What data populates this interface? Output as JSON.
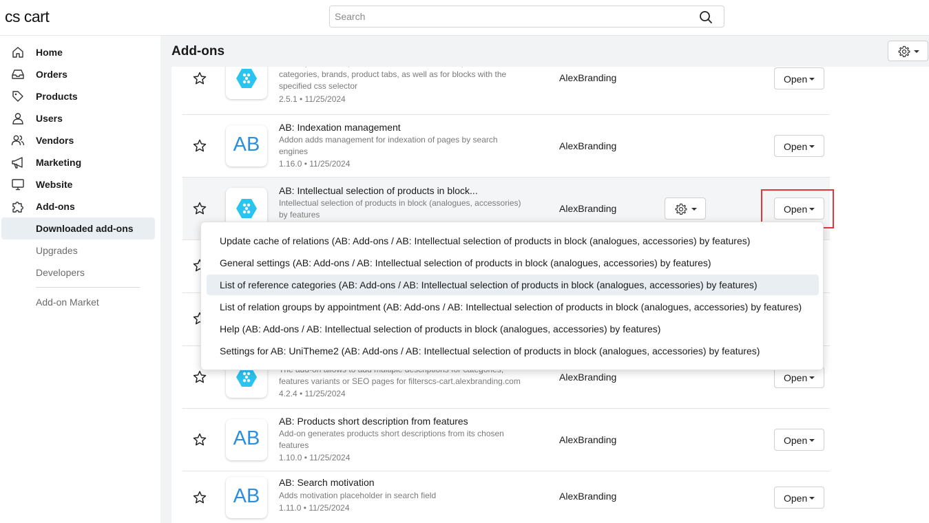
{
  "app": {
    "logo": "cs cart"
  },
  "search": {
    "placeholder": "Search"
  },
  "sidebar": {
    "items": [
      {
        "label": "Home",
        "icon": "home-icon"
      },
      {
        "label": "Orders",
        "icon": "inbox-icon"
      },
      {
        "label": "Products",
        "icon": "tag-icon"
      },
      {
        "label": "Users",
        "icon": "user-icon"
      },
      {
        "label": "Vendors",
        "icon": "users-icon"
      },
      {
        "label": "Marketing",
        "icon": "megaphone-icon"
      },
      {
        "label": "Website",
        "icon": "monitor-icon"
      },
      {
        "label": "Add-ons",
        "icon": "puzzle-icon"
      }
    ],
    "subitems": [
      {
        "label": "Downloaded add-ons",
        "active": true
      },
      {
        "label": "Upgrades",
        "active": false
      },
      {
        "label": "Developers",
        "active": false
      }
    ],
    "market": "Add-on Market"
  },
  "page": {
    "title": "Add-ons"
  },
  "addons": [
    {
      "title": "",
      "desc": "Allows you to hide part of the content in the description of categories, brands, product tabs, as well as for blocks with the specified css selector",
      "version": "2.5.1 • 11/25/2024",
      "developer": "AlexBranding",
      "icon": "hexagon-logo-icon",
      "action": "Open"
    },
    {
      "title": "AB: Indexation management",
      "desc": "Addon adds management for indexation of pages by search engines",
      "version": "1.16.0 • 11/25/2024",
      "developer": "AlexBranding",
      "icon": "ab-logo-icon",
      "action": "Open"
    },
    {
      "title": "AB: Intellectual selection of products in block...",
      "desc": "Intellectual selection of products in block (analogues, accessories) by features",
      "version": "",
      "developer": "AlexBranding",
      "icon": "hexagon-logo-icon",
      "action": "Open"
    },
    {
      "title": "",
      "desc": "The add-on allows to add multiple descriptions for categories, features variants or SEO pages for filterscs-cart.alexbranding.com",
      "version": "4.2.4 • 11/25/2024",
      "developer": "AlexBranding",
      "icon": "hexagon-logo-icon",
      "action": "Open"
    },
    {
      "title": "AB: Products short description from features",
      "desc": "Add-on generates products short descriptions from its chosen features",
      "version": "1.10.0 • 11/25/2024",
      "developer": "AlexBranding",
      "icon": "ab-logo-icon",
      "action": "Open"
    },
    {
      "title": "AB: Search motivation",
      "desc": "Adds motivation placeholder in search field",
      "version": "1.11.0 • 11/25/2024",
      "developer": "AlexBranding",
      "icon": "ab-logo-icon",
      "action": "Open"
    }
  ],
  "tile_text": "AB",
  "dropdown": {
    "items": [
      {
        "label": "Update cache of relations (AB: Add-ons / AB: Intellectual selection of products in block (analogues, accessories) by features)"
      },
      {
        "label": "General settings (AB: Add-ons / AB: Intellectual selection of products in block (analogues, accessories) by features)"
      },
      {
        "label": "List of reference categories (AB: Add-ons / AB: Intellectual selection of products in block (analogues, accessories) by features)"
      },
      {
        "label": "List of relation groups by appointment (AB: Add-ons / AB: Intellectual selection of products in block (analogues, accessories) by features)"
      },
      {
        "label": "Help (AB: Add-ons / AB: Intellectual selection of products in block (analogues, accessories) by features)"
      },
      {
        "label": "Settings for AB: UniTheme2 (AB: Add-ons / AB: Intellectual selection of products in block (analogues, accessories) by features)"
      }
    ],
    "active_index": 2
  },
  "colors": {
    "accent_blue": "#2b8fe0",
    "hex_logo": "#29c4f0",
    "highlight_red": "#e0383a",
    "active_bg": "#e9eef3"
  }
}
